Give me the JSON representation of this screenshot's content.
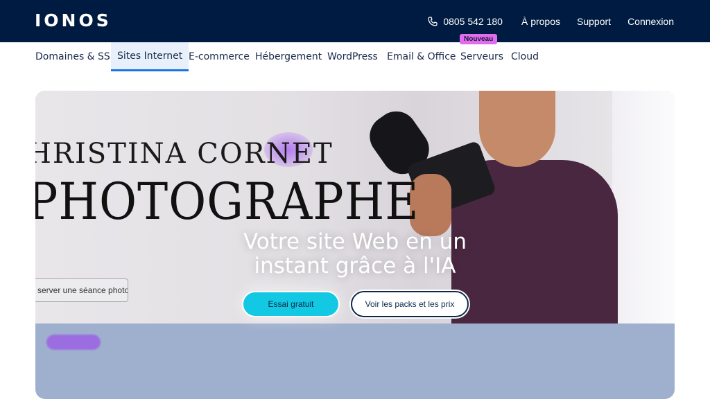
{
  "header": {
    "logo": "IONOS",
    "phone": "0805 542 180",
    "links": [
      "À propos",
      "Support",
      "Connexion"
    ]
  },
  "nav": {
    "items": [
      "Domaines & SSL",
      "Sites Internet",
      "E-commerce",
      "Hébergement",
      "WordPress",
      "Email & Office",
      "Serveurs",
      "Cloud"
    ],
    "active": "Sites Internet",
    "badge": "Nouveau"
  },
  "hero": {
    "photo_name": "HRISTINA CORNET",
    "photo_title": "PHOTOGRAPHE",
    "photo_button": "server une séance photo",
    "headline": "Votre site Web en un instant grâce à l'IA",
    "cta_primary": "Essai gratuit",
    "cta_secondary": "Voir les packs et les prix"
  },
  "colors": {
    "header_bg": "#001b41",
    "accent": "#12c8e2",
    "badge": "#e06cf0",
    "hero_lower": "#9fb0ce"
  }
}
